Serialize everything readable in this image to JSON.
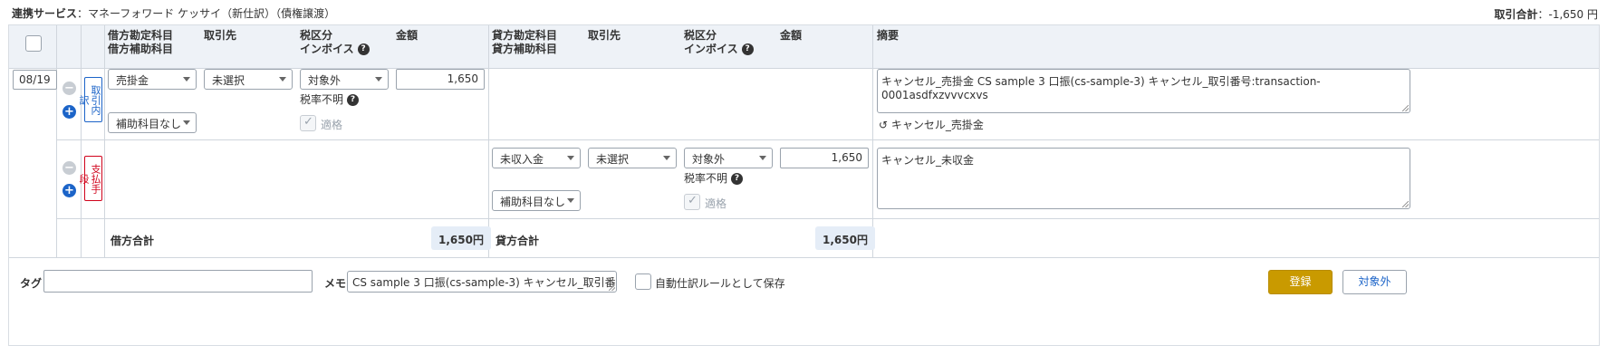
{
  "top": {
    "service_label": "連携サービス",
    "service_value": "：マネーフォワード ケッサイ（新仕訳）（債権譲渡）",
    "total_label": "取引合計",
    "total_value": "：-1,650 円"
  },
  "header": {
    "debit_account": "借方勘定科目",
    "debit_sub": "借方補助科目",
    "partner": "取引先",
    "tax": "税区分",
    "invoice": "インボイス",
    "amount": "金額",
    "credit_account": "貸方勘定科目",
    "credit_sub": "貸方補助科目",
    "partner2": "取引先",
    "tax2": "税区分",
    "invoice2": "インボイス",
    "amount2": "金額",
    "memo": "摘要",
    "help": "?"
  },
  "row1": {
    "date": "08/19",
    "tag": "取引内訳",
    "debit_account": "売掛金",
    "partner": "未選択",
    "tax": "対象外",
    "amount": "1,650",
    "rate_unknown": "税率不明",
    "sub_account": "補助科目なし",
    "eligible": "適格",
    "memo": "キャンセル_売掛金 CS sample 3 口振(cs-sample-3) キャンセル_取引番号:transaction-0001asdfxzvvvcxvs",
    "revert_label": "キャンセル_売掛金"
  },
  "row2": {
    "tag": "支払手段",
    "credit_account": "未収入金",
    "partner": "未選択",
    "tax": "対象外",
    "amount": "1,650",
    "rate_unknown": "税率不明",
    "sub_account": "補助科目なし",
    "eligible": "適格",
    "memo": "キャンセル_未収金"
  },
  "totals": {
    "debit_label": "借方合計",
    "debit_value": "1,650円",
    "credit_label": "貸方合計",
    "credit_value": "1,650円"
  },
  "footer": {
    "tag_label": "タグ",
    "memo_label": "メモ",
    "memo_value": "CS sample 3 口振(cs-sample-3) キャンセル_取引番",
    "auto_rule": "自動仕訳ルールとして保存",
    "register": "登録",
    "exclude": "対象外"
  },
  "colors": {
    "accent": "#c99a00",
    "link": "#1c64c8",
    "danger": "#d0021b",
    "header_bg": "#eef2f7"
  },
  "icons": [
    "minus-circle-icon",
    "plus-circle-icon",
    "help-icon",
    "chevron-down-icon",
    "undo-icon",
    "check-icon"
  ]
}
